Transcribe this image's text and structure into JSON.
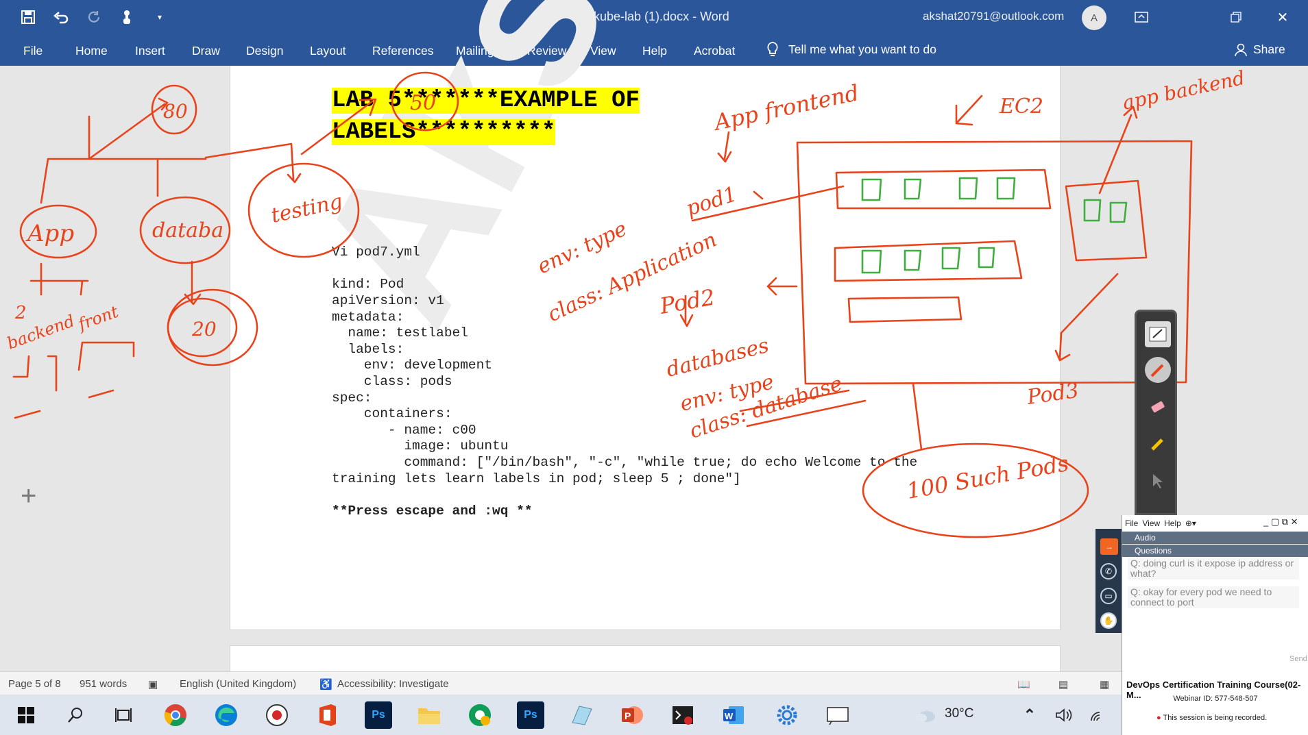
{
  "window": {
    "doc_title": "minikube-lab (1).docx  -  Word",
    "account": "akshat20791@outlook.com",
    "avatar_initial": "A"
  },
  "quick_access": [
    "save-icon",
    "undo-icon",
    "redo-icon",
    "touch-mode-icon",
    "customize-icon"
  ],
  "ribbon": {
    "tabs": [
      "File",
      "Home",
      "Insert",
      "Draw",
      "Design",
      "Layout",
      "References",
      "Mailings",
      "Review",
      "View",
      "Help",
      "Acrobat"
    ],
    "tell_me": "Tell me what you want to do",
    "share": "Share"
  },
  "document": {
    "title_line1": "LAB 5*******EXAMPLE OF",
    "title_line2": "LABELS**********",
    "code_lines": [
      "Vi pod7.yml",
      "",
      "kind: Pod",
      "apiVersion: v1",
      "metadata:",
      "  name: testlabel",
      "  labels:",
      "    env: development",
      "    class: pods",
      "spec:",
      "    containers:",
      "       - name: c00",
      "         image: ubuntu",
      "         command: [\"/bin/bash\", \"-c\", \"while true; do echo Welcome to the",
      "training lets learn labels in pod; sleep 5 ; done\"]",
      "",
      "**Press escape and :wq **"
    ],
    "watermark": "Akshat"
  },
  "ink_annotations": {
    "left": [
      "80",
      "20",
      "App",
      "databa",
      "testing",
      "backend",
      "front",
      "2"
    ],
    "right": [
      "App frontend",
      "EC2",
      "app backend",
      "pod1",
      "env: type",
      "class: Application",
      "Pod2",
      "databases",
      "env: type",
      "class: database",
      "Pod3",
      "100 Such Pods",
      "50"
    ]
  },
  "statusbar": {
    "page": "Page 5 of 8",
    "words": "951 words",
    "language": "English (United Kingdom)",
    "accessibility": "Accessibility: Investigate"
  },
  "taskbar": {
    "apps": [
      "windows-start-icon",
      "search-icon",
      "task-view-icon",
      "chrome-icon",
      "edge-icon",
      "record-icon",
      "office-icon",
      "photoshop-icon",
      "file-explorer-icon",
      "chrome-profile-icon",
      "photoshop-icon",
      "notes-icon",
      "powerpoint-icon",
      "terminal-icon",
      "word-icon",
      "settings-gear-icon",
      "screen-sketch-icon"
    ],
    "temperature": "30°C"
  },
  "webinar": {
    "menu": [
      "File",
      "View",
      "Help"
    ],
    "audio_label": "Audio",
    "questions_label": "Questions",
    "questions": [
      "Q: doing curl is it expose ip address or what?",
      "Q: okay for every pod we need to connect to port"
    ],
    "send": "Send",
    "course_title": "DevOps Certification Training Course(02-M...",
    "webinar_id": "Webinar ID: 577-548-507",
    "recording": "This session is being recorded."
  },
  "colors": {
    "word_blue": "#2b579a",
    "ink_red": "#e8431a",
    "highlight": "#ffff00"
  }
}
